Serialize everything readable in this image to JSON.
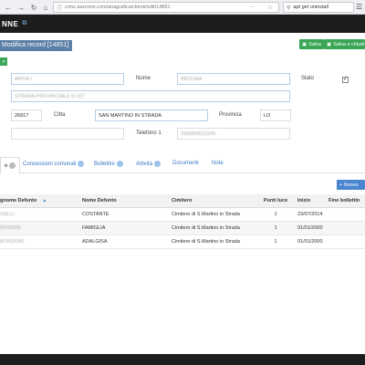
{
  "browser": {
    "url": "crms.aaronne.com/anagrafica/clienti/edit/14851",
    "search_text": "apt get uninstall"
  },
  "app": {
    "brand": "NNE"
  },
  "page": {
    "title": "Modifica record [14851]",
    "save_label": "Salva",
    "save_close_label": "Salva e chiudi"
  },
  "form": {
    "cognome_value": "APPIA I",
    "nome_label": "Nome",
    "nome_value": "PAOLINA",
    "stato_label": "Stato",
    "indirizzo_value": "STRADA PROVINCIALE N.107",
    "cap_value": "26817",
    "citta_label": "Citta",
    "citta_value": "SAN MARTINO IN STRADA",
    "provincia_label": "Provincia",
    "provincia_value": "LO",
    "telefono_label": "Telefono 1",
    "telefono_value": "3356809/12345"
  },
  "tabs": [
    {
      "label": "e"
    },
    {
      "label": "Concessioni comunali"
    },
    {
      "label": "Bollettini"
    },
    {
      "label": "Attività"
    },
    {
      "label": "Documenti"
    },
    {
      "label": "Note"
    }
  ],
  "table": {
    "new_label": "Nuovo",
    "headers": [
      "gnome Defunto",
      "Nome Defunto",
      "Cimitero",
      "Punti luce",
      "Inizio",
      "Fine bollettin"
    ],
    "rows": [
      {
        "cognome": "GALLI",
        "nome": "COSTANTE",
        "cimitero": "Cimitero di S.Martino in Strada",
        "punti": "1",
        "inizio": "23/07/2014",
        "fine": ""
      },
      {
        "cognome": "ROSSINI",
        "nome": "FAMIGLIA",
        "cimitero": "Cimitero di S.Martino in Strada",
        "punti": "1",
        "inizio": "01/01/2000",
        "fine": ""
      },
      {
        "cognome": "BORDONI",
        "nome": "ADALGISA",
        "cimitero": "Cimitero di S.Martino in Strada",
        "punti": "1",
        "inizio": "01/01/2000",
        "fine": ""
      }
    ]
  },
  "colors": {
    "header_bg": "#1d1d1d",
    "title_bg": "#5b7fa6",
    "save_green": "#3aa655",
    "primary_blue": "#4a86d0",
    "link_blue": "#3a77c5"
  },
  "icons": {
    "external": "external-link-icon",
    "lock": "lock-icon",
    "search": "search-icon",
    "star": "star-icon",
    "menu": "hamburger-icon"
  }
}
